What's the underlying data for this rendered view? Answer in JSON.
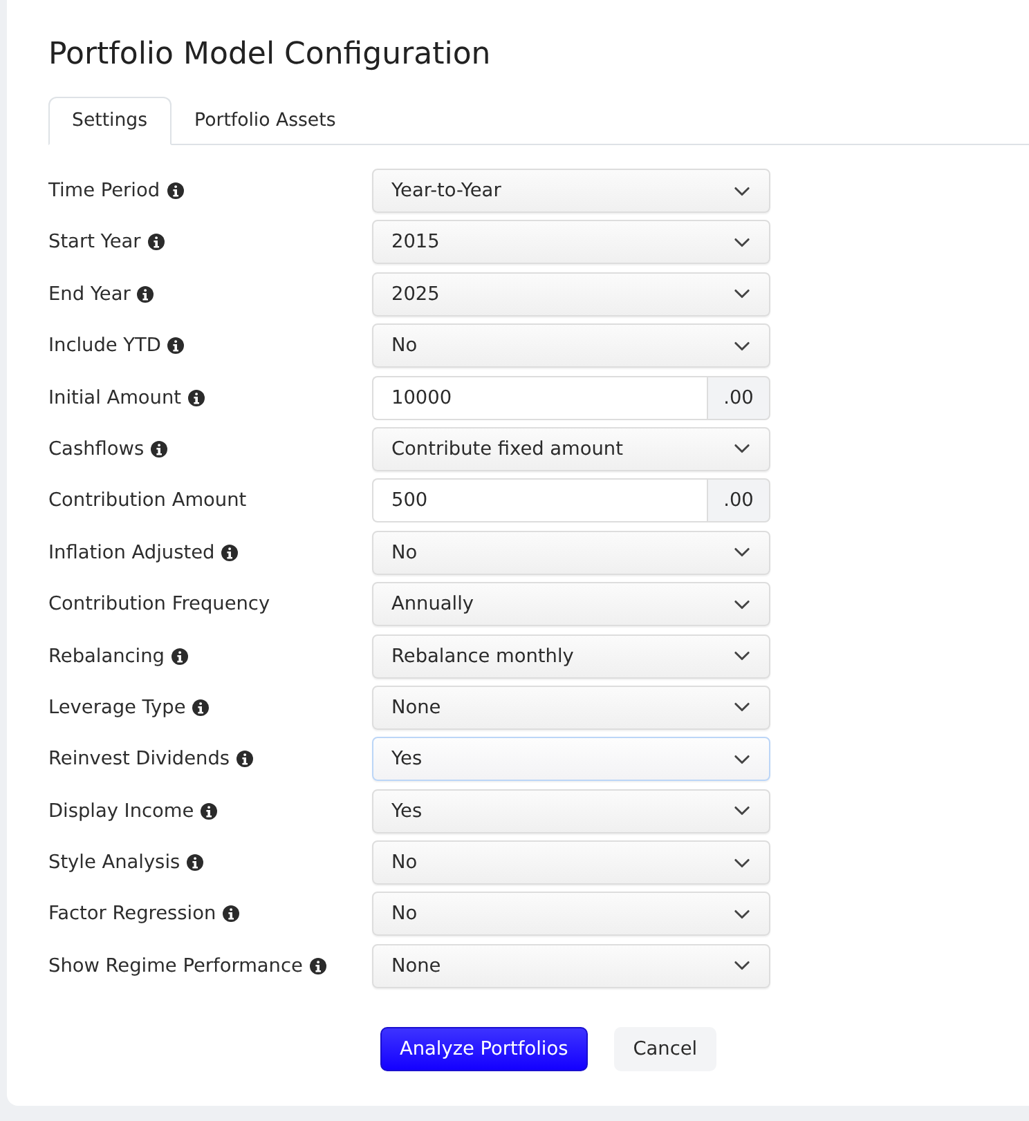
{
  "title": "Portfolio Model Configuration",
  "tabs": [
    {
      "label": "Settings",
      "selected": true
    },
    {
      "label": "Portfolio Assets",
      "selected": false
    }
  ],
  "fields": [
    {
      "label": "Time Period",
      "info": true,
      "kind": "select",
      "value": "Year-to-Year",
      "focused": false
    },
    {
      "label": "Start Year",
      "info": true,
      "kind": "select",
      "value": "2015",
      "focused": false
    },
    {
      "label": "End Year",
      "info": true,
      "kind": "select",
      "value": "2025",
      "focused": false
    },
    {
      "label": "Include YTD",
      "info": true,
      "kind": "select",
      "value": "No",
      "focused": false
    },
    {
      "label": "Initial Amount",
      "info": true,
      "kind": "amount",
      "value": "10000",
      "suffix": ".00",
      "focused": false
    },
    {
      "label": "Cashflows",
      "info": true,
      "kind": "select",
      "value": "Contribute fixed amount",
      "focused": false
    },
    {
      "label": "Contribution Amount",
      "info": false,
      "kind": "amount",
      "value": "500",
      "suffix": ".00",
      "focused": false
    },
    {
      "label": "Inflation Adjusted",
      "info": true,
      "kind": "select",
      "value": "No",
      "focused": false
    },
    {
      "label": "Contribution Frequency",
      "info": false,
      "kind": "select",
      "value": "Annually",
      "focused": false
    },
    {
      "label": "Rebalancing",
      "info": true,
      "kind": "select",
      "value": "Rebalance monthly",
      "focused": false
    },
    {
      "label": "Leverage Type",
      "info": true,
      "kind": "select",
      "value": "None",
      "focused": false
    },
    {
      "label": "Reinvest Dividends",
      "info": true,
      "kind": "select",
      "value": "Yes",
      "focused": true
    },
    {
      "label": "Display Income",
      "info": true,
      "kind": "select",
      "value": "Yes",
      "focused": false
    },
    {
      "label": "Style Analysis",
      "info": true,
      "kind": "select",
      "value": "No",
      "focused": false
    },
    {
      "label": "Factor Regression",
      "info": true,
      "kind": "select",
      "value": "No",
      "focused": false
    },
    {
      "label": "Show Regime Performance",
      "info": true,
      "kind": "select",
      "value": "None",
      "focused": false
    }
  ],
  "buttons": [
    {
      "label": "Analyze Portfolios",
      "kind": "primary"
    },
    {
      "label": "Cancel",
      "kind": "secondary"
    }
  ]
}
